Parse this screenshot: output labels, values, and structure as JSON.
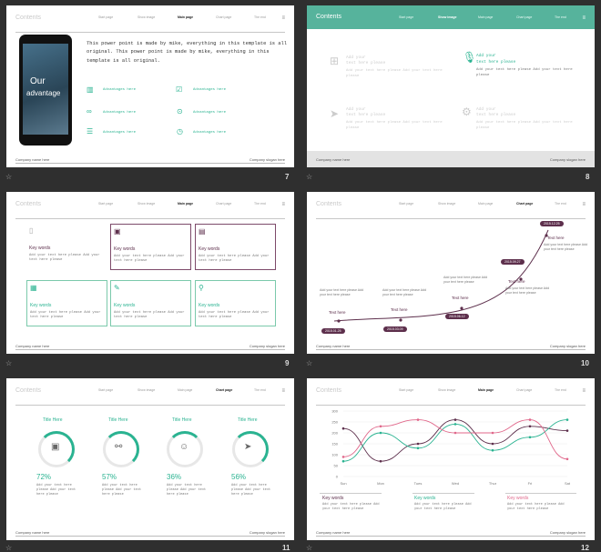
{
  "slide7": {
    "number": "7",
    "nav": [
      "Start page",
      "Show image",
      "Main page",
      "Chart page",
      "The end"
    ],
    "phone_line1": "Our",
    "phone_line2": "advantage",
    "body": "This power point is made by mike, everything in this template is all original. This power point is made by mike, everything in this template is all original.",
    "items": [
      "Advantages here",
      "Advantages here",
      "Advantages here",
      "Advantages here",
      "Advantages here",
      "Advantages here"
    ],
    "footer_left": "Company name here",
    "footer_right": "Company slogan here"
  },
  "slide8": {
    "number": "8",
    "title": "Contents",
    "nav": [
      "Start page",
      "Show image",
      "Main page",
      "Chart page",
      "The end"
    ],
    "cells": [
      {
        "h1": "Add your",
        "h2": "text here please",
        "body": "Add your text here please Add your text here please"
      },
      {
        "h1": "Add your",
        "h2": "text here please",
        "body": "Add your text here please Add your text here please"
      },
      {
        "h1": "Add your",
        "h2": "text here please",
        "body": "Add your text here please Add your text here please"
      },
      {
        "h1": "Add your",
        "h2": "text here please",
        "body": "Add your text here please Add your text here please"
      }
    ],
    "footer_left": "Company name here",
    "footer_right": "Company slogan here"
  },
  "slide9": {
    "number": "9",
    "title": "Contents",
    "nav": [
      "Start page",
      "Show image",
      "Main page",
      "Chart page",
      "The end"
    ],
    "cards": [
      {
        "title": "Key words",
        "body": "Add your text here please Add your text here please"
      },
      {
        "title": "Key words",
        "body": "Add your text here please Add your text here please"
      },
      {
        "title": "Key words",
        "body": "Add your text here please Add your text here please"
      },
      {
        "title": "Key words",
        "body": "Add your text here please Add your text here please"
      },
      {
        "title": "Key words",
        "body": "Add your text here please Add your text here please"
      },
      {
        "title": "Key words",
        "body": "Add your text here please Add your text here please"
      }
    ],
    "footer_left": "Company name here",
    "footer_right": "Company slogan here"
  },
  "slide10": {
    "number": "10",
    "title": "Contents",
    "nav": [
      "Start page",
      "Show image",
      "Main page",
      "Chart page",
      "The end"
    ],
    "dates": [
      "2015.01.25",
      "2015.03.09",
      "2015.06.12",
      "2015.09.27",
      "2015.12.25"
    ],
    "notes_title": "Text here",
    "notes_body": "Add your text here please Add your text here please",
    "footer_left": "Company name here",
    "footer_right": "Company slogan here"
  },
  "slide11": {
    "number": "11",
    "title": "Contents",
    "nav": [
      "Start page",
      "Show image",
      "Main page",
      "Chart page",
      "The end"
    ],
    "items": [
      {
        "title": "Title Here",
        "pct": "72%",
        "body": "Add your text here please Add your text here please"
      },
      {
        "title": "Title Here",
        "pct": "57%",
        "body": "Add your text here please Add your text here please"
      },
      {
        "title": "Title Here",
        "pct": "36%",
        "body": "Add your text here please Add your text here please"
      },
      {
        "title": "Title Here",
        "pct": "56%",
        "body": "Add your text here please Add your text here please"
      }
    ],
    "footer_left": "Company name here",
    "footer_right": "Company slogan here"
  },
  "slide12": {
    "number": "12",
    "title": "Contents",
    "nav": [
      "Start page",
      "Show image",
      "Main page",
      "Chart page",
      "The end"
    ],
    "legend": [
      {
        "title": "Key words",
        "body": "Add your text here please Add your text here please"
      },
      {
        "title": "Key words",
        "body": "Add your text here please Add your text here please"
      },
      {
        "title": "Key words",
        "body": "Add your text here please Add your text here please"
      }
    ],
    "footer_left": "Company name here",
    "footer_right": "Company slogan here"
  },
  "colors": {
    "green": "#2ab391",
    "purple": "#5d2f4c",
    "pink": "#e0678a"
  },
  "chart_data": {
    "type": "line",
    "categories": [
      "Sun",
      "Mon",
      "Tues",
      "Wed",
      "Thur",
      "Fri",
      "Sat"
    ],
    "ylim": [
      0,
      300
    ],
    "yticks": [
      "300",
      "250",
      "200",
      "150",
      "100",
      "50",
      "0"
    ],
    "series": [
      {
        "values": [
          220,
          70,
          150,
          260,
          150,
          230,
          210
        ],
        "color": "#5d2f4c"
      },
      {
        "values": [
          70,
          200,
          130,
          240,
          120,
          180,
          260
        ],
        "color": "#2ab391"
      },
      {
        "values": [
          90,
          230,
          260,
          200,
          200,
          260,
          80
        ],
        "color": "#e0678a"
      }
    ]
  }
}
